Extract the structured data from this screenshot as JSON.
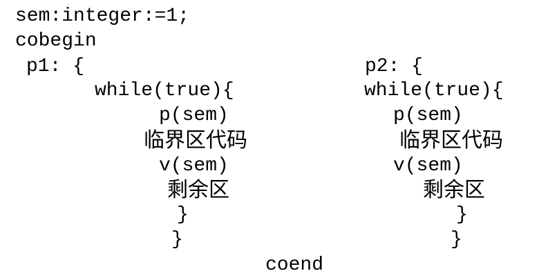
{
  "document": {
    "lines": {
      "decl": "sem:integer:=1;",
      "cobegin": "cobegin",
      "coend": "coend"
    },
    "p1": {
      "header": "p1: {",
      "while": "while(true){",
      "p_sem": "p(sem)",
      "critical": "临界区代码",
      "v_sem": "v(sem)",
      "remainder": "剩余区",
      "close_inner": "}",
      "close_outer": "}"
    },
    "p2": {
      "header": "p2: {",
      "while": "while(true){",
      "p_sem": "p(sem)",
      "critical": "临界区代码",
      "v_sem": "v(sem)",
      "remainder": "剩余区",
      "close_inner": "}",
      "close_outer": "}"
    }
  }
}
